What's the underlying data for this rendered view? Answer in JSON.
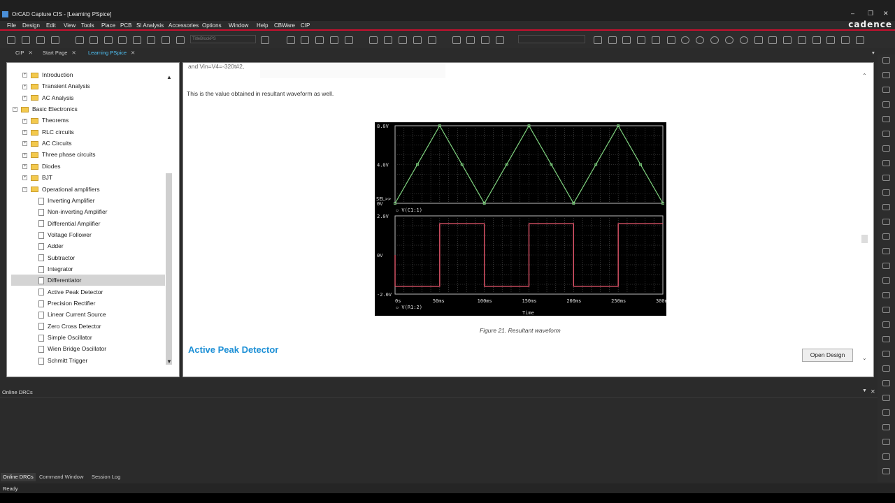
{
  "window": {
    "title": "OrCAD Capture CIS - [Learning PSpice]"
  },
  "brand": "cadence",
  "menu": [
    "File",
    "Design",
    "Edit",
    "View",
    "Tools",
    "Place",
    "PCB",
    "SI Analysis",
    "Accessories",
    "Options",
    "Window",
    "Help",
    "CBWare",
    "CIP"
  ],
  "toolbar": {
    "title_block_combo": "TitleBlockPS"
  },
  "tabs": [
    {
      "label": "CIP",
      "active": false
    },
    {
      "label": "Start Page",
      "active": false
    },
    {
      "label": "Learning PSpice",
      "active": true
    }
  ],
  "tree": {
    "items": [
      {
        "label": "Introduction",
        "kind": "folder",
        "indent": 1,
        "expander": "+"
      },
      {
        "label": "Transient Analysis",
        "kind": "folder",
        "indent": 1,
        "expander": "+"
      },
      {
        "label": "AC Analysis",
        "kind": "folder",
        "indent": 1,
        "expander": "+"
      },
      {
        "label": "Basic Electronics",
        "kind": "folder",
        "indent": 0,
        "expander": "−"
      },
      {
        "label": "Theorems",
        "kind": "folder",
        "indent": 1,
        "expander": "+"
      },
      {
        "label": "RLC circuits",
        "kind": "folder",
        "indent": 1,
        "expander": "+"
      },
      {
        "label": "AC Circuits",
        "kind": "folder",
        "indent": 1,
        "expander": "+"
      },
      {
        "label": "Three phase circuits",
        "kind": "folder",
        "indent": 1,
        "expander": "+"
      },
      {
        "label": "Diodes",
        "kind": "folder",
        "indent": 1,
        "expander": "+"
      },
      {
        "label": "BJT",
        "kind": "folder",
        "indent": 1,
        "expander": "+"
      },
      {
        "label": "Operational amplifiers",
        "kind": "folder",
        "indent": 1,
        "expander": "−"
      },
      {
        "label": "Inverting Amplifier",
        "kind": "doc",
        "indent": 2
      },
      {
        "label": "Non-inverting Amplifier",
        "kind": "doc",
        "indent": 2
      },
      {
        "label": "Differential Amplifier",
        "kind": "doc",
        "indent": 2
      },
      {
        "label": "Voltage Follower",
        "kind": "doc",
        "indent": 2
      },
      {
        "label": "Adder",
        "kind": "doc",
        "indent": 2
      },
      {
        "label": "Subtractor",
        "kind": "doc",
        "indent": 2
      },
      {
        "label": "Integrator",
        "kind": "doc",
        "indent": 2
      },
      {
        "label": "Differentiator",
        "kind": "doc",
        "indent": 2,
        "selected": true
      },
      {
        "label": "Active Peak Detector",
        "kind": "doc",
        "indent": 2
      },
      {
        "label": "Precision Rectifier",
        "kind": "doc",
        "indent": 2
      },
      {
        "label": "Linear Current Source",
        "kind": "doc",
        "indent": 2
      },
      {
        "label": "Zero Cross Detector",
        "kind": "doc",
        "indent": 2
      },
      {
        "label": "Simple Oscillator",
        "kind": "doc",
        "indent": 2
      },
      {
        "label": "Wien Bridge Oscillator",
        "kind": "doc",
        "indent": 2
      },
      {
        "label": "Schmitt Trigger",
        "kind": "doc",
        "indent": 2
      }
    ]
  },
  "doc": {
    "partial_line": "and Vin=V4=-320t#2,",
    "paragraph": "This is the value obtained in resultant waveform as well.",
    "figure_caption": "Figure 21. Resultant waveform",
    "section_heading": "Active Peak Detector",
    "open_design_label": "Open Design",
    "figure": {
      "top": {
        "yticks": [
          "8.0V",
          "4.0V",
          "0V"
        ],
        "sel_label": "SEL>>",
        "trace_label": "V(C1:1)",
        "color": "#7fd27f",
        "x": [
          0,
          50,
          100,
          150,
          200,
          250,
          300
        ],
        "y": [
          0,
          8,
          0,
          8,
          0,
          8,
          0
        ]
      },
      "bottom": {
        "yticks": [
          "2.0V",
          "0V",
          "-2.0V"
        ],
        "xticks": [
          "0s",
          "50ms",
          "100ms",
          "150ms",
          "200ms",
          "250ms",
          "300ms"
        ],
        "xlabel": "Time",
        "trace_label": "V(R1:2)",
        "color": "#e0556a",
        "x": [
          0,
          50,
          50,
          100,
          100,
          150,
          150,
          200,
          200,
          250,
          250,
          300
        ],
        "y": [
          -1.6,
          -1.6,
          1.6,
          1.6,
          -1.6,
          -1.6,
          1.6,
          1.6,
          -1.6,
          -1.6,
          1.6,
          1.6
        ]
      }
    }
  },
  "bottom_panel": {
    "title": "Online DRCs",
    "tabs": [
      {
        "label": "Online DRCs",
        "active": true
      },
      {
        "label": "Command Window",
        "active": false
      },
      {
        "label": "Session Log",
        "active": false
      }
    ]
  },
  "status": {
    "text": "Ready"
  }
}
